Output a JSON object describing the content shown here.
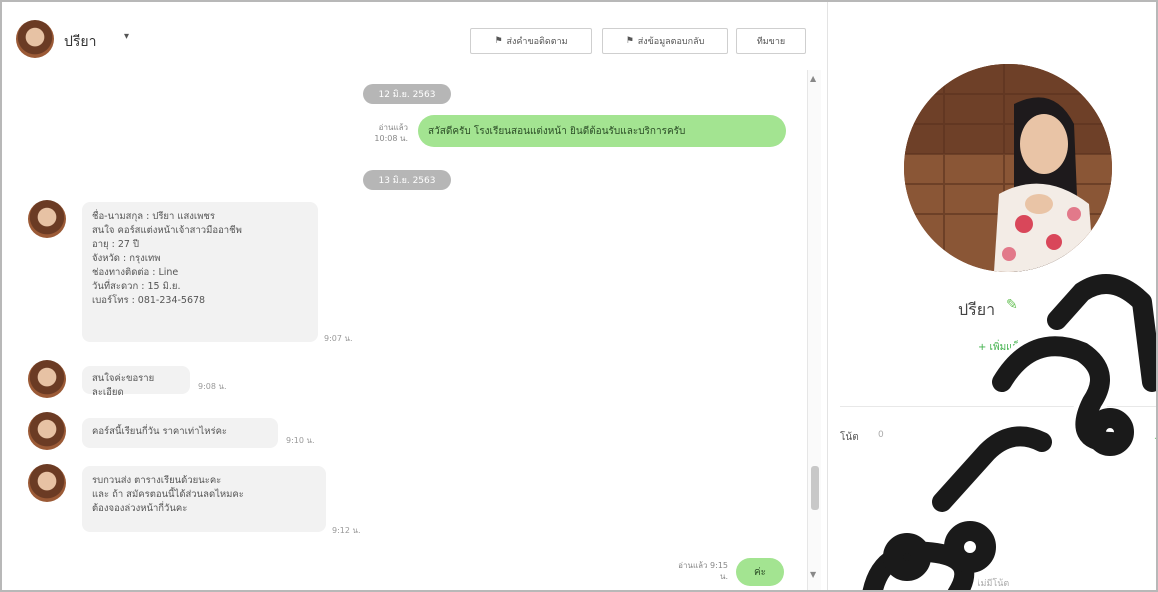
{
  "header": {
    "contact_name": "ปรียา",
    "caret": "▾",
    "buttons": [
      {
        "icon": "⚑",
        "label": "ส่งคำขอติดตาม"
      },
      {
        "icon": "⚑",
        "label": "ส่งข้อมูลตอบกลับ"
      },
      {
        "icon": "",
        "label": "ทีมขาย"
      }
    ]
  },
  "chat": {
    "date_pill_1": "12 มิ.ย. 2563",
    "date_pill_2": "13 มิ.ย. 2563",
    "sent_1": {
      "meta": "อ่านแล้ว\n10:08 น.",
      "text": "สวัสดีครับ โรงเรียนสอนแต่งหน้า ยินดีต้อนรับและบริการครับ"
    },
    "recv_1": {
      "text": "ชื่อ-นามสกุล : ปรียา แสงเพชร\nสนใจ คอร์สแต่งหน้าเจ้าสาวมืออาชีพ\nอายุ : 27 ปี\nจังหวัด : กรุงเทพ\nช่องทางติดต่อ : Line\nวันที่สะดวก : 15 มิ.ย.\nเบอร์โทร : 081-234-5678",
      "time": "9:07 น."
    },
    "recv_2": {
      "text": "สนใจค่ะขอรายละเอียด",
      "time": "9:08 น."
    },
    "recv_3": {
      "text": "คอร์สนี้เรียนกี่วัน ราคาเท่าไหร่คะ",
      "time": "9:10 น."
    },
    "recv_4": {
      "text": "รบกวนส่ง ตารางเรียนด้วยนะคะ\nและ ถ้า สมัครตอนนี้ได้ส่วนลดไหมคะ\nต้องจองล่วงหน้ากี่วันคะ",
      "time": "9:12 น."
    },
    "sent_2": {
      "meta": "อ่านแล้ว\n9:15 น.",
      "text": "ค่ะ"
    }
  },
  "panel": {
    "name": "ปรียา",
    "edit_icon": "✎",
    "add_tag": "+ เพิ่มแท็ก",
    "notes_label": "โน้ต",
    "notes_count": "0",
    "notes_accent": "+",
    "footer": "ไม่มีโน้ต"
  },
  "colors": {
    "sent_bubble": "#a3e491",
    "received_bubble": "#f2f2f2",
    "date_pill": "#b6b6b6",
    "accent_green": "#3fb04a",
    "watermark": "#1a1a1a"
  },
  "watermark": {
    "text": "ดราม่า"
  }
}
